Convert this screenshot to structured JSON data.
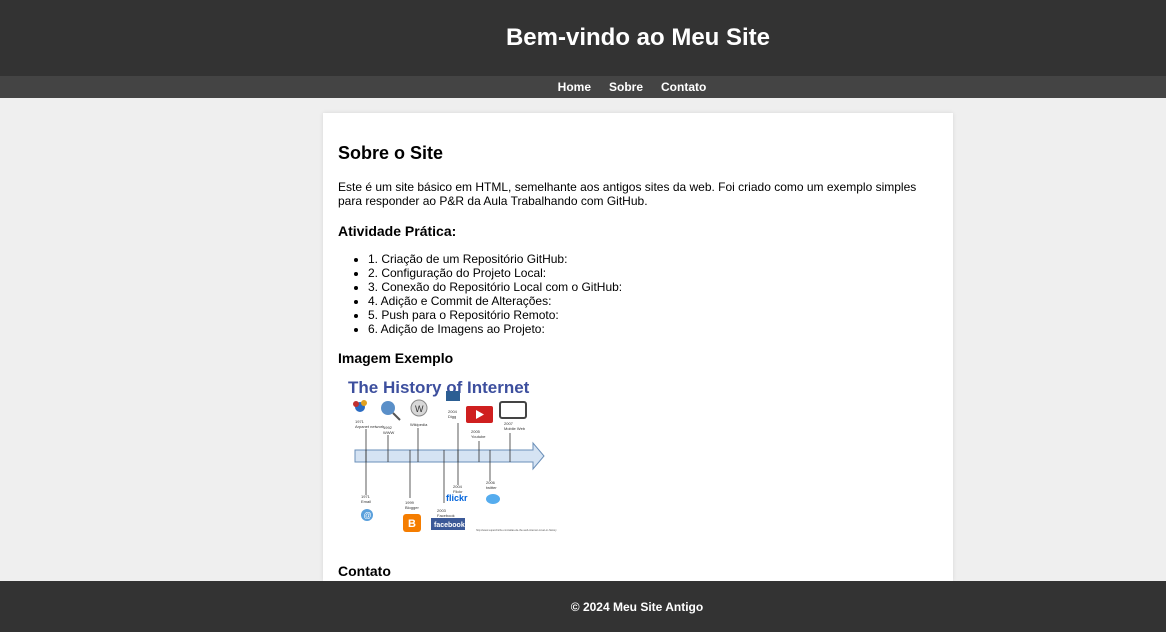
{
  "header": {
    "title": "Bem-vindo ao Meu Site"
  },
  "nav": {
    "items": [
      "Home",
      "Sobre",
      "Contato"
    ]
  },
  "main": {
    "title": "Sobre o Site",
    "description": "Este é um site básico em HTML, semelhante aos antigos sites da web. Foi criado como um exemplo simples para responder ao P&R da Aula Trabalhando com GitHub.",
    "activity_title": "Atividade Prática:",
    "steps": [
      "1. Criação de um Repositório GitHub:",
      "2. Configuração do Projeto Local:",
      "3. Conexão do Repositório Local com o GitHub:",
      "4. Adição e Commit de Alterações:",
      "5. Push para o Repositório Remoto:",
      "6. Adição de Imagens ao Projeto:"
    ],
    "image_title": "Imagem Exemplo",
    "image": {
      "title": "The History of Internet",
      "top_items": [
        {
          "year": "1971",
          "label": "Arpanet network"
        },
        {
          "year": "1992",
          "label": "WWW"
        },
        {
          "year": "",
          "label": "Wikipedia"
        },
        {
          "year": "2004",
          "label": "Digg"
        },
        {
          "year": "2005",
          "label": "Youtube"
        },
        {
          "year": "2007",
          "label": "Mobile Web"
        }
      ],
      "bottom_items": [
        {
          "year": "1971",
          "label": "Email"
        },
        {
          "year": "1999",
          "label": "Blogger"
        },
        {
          "year": "2003",
          "label": "Facebook"
        },
        {
          "year": "2004",
          "label": "Flickr"
        },
        {
          "year": "2006",
          "label": "twitter"
        }
      ],
      "flickr_text": "flickr",
      "facebook_text": "facebook",
      "source_url": "http://www.superchiche.com/atlas-de-the-web-internet-novel-or-history"
    },
    "contact_title": "Contato"
  },
  "footer": {
    "text": "© 2024 Meu Site Antigo"
  },
  "colors": {
    "header_bg": "#333333",
    "nav_bg": "#444444",
    "page_bg": "#efefef",
    "accent_blue": "#3d4f9e",
    "arrow_fill": "#d5e3f3"
  }
}
